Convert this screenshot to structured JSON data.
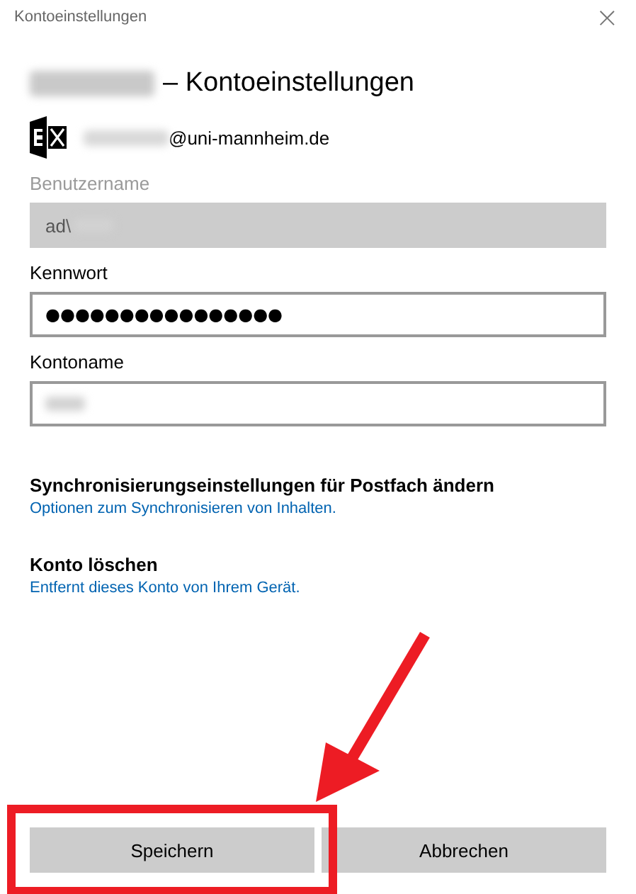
{
  "window": {
    "title": "Kontoeinstellungen",
    "close": "×"
  },
  "heading": "– Kontoeinstellungen",
  "account": {
    "email_domain": "@uni-mannheim.de"
  },
  "fields": [
    {
      "label": "Benutzername",
      "value": "ad\\",
      "disabled": true,
      "kind": "text"
    },
    {
      "label": "Kennwort",
      "value": "●●●●●●●●●●●●●●●●",
      "disabled": false,
      "kind": "password"
    },
    {
      "label": "Kontoname",
      "disabled": false,
      "kind": "text"
    }
  ],
  "sections": [
    {
      "title": "Synchronisierungseinstellungen für Postfach ändern",
      "link": "Optionen zum Synchronisieren von Inhalten."
    },
    {
      "title": "Konto löschen",
      "link": "Entfernt dieses Konto von Ihrem Gerät."
    }
  ],
  "buttons": [
    {
      "label": "Speichern",
      "highlighted": true
    },
    {
      "label": "Abbrechen",
      "highlighted": false
    }
  ]
}
